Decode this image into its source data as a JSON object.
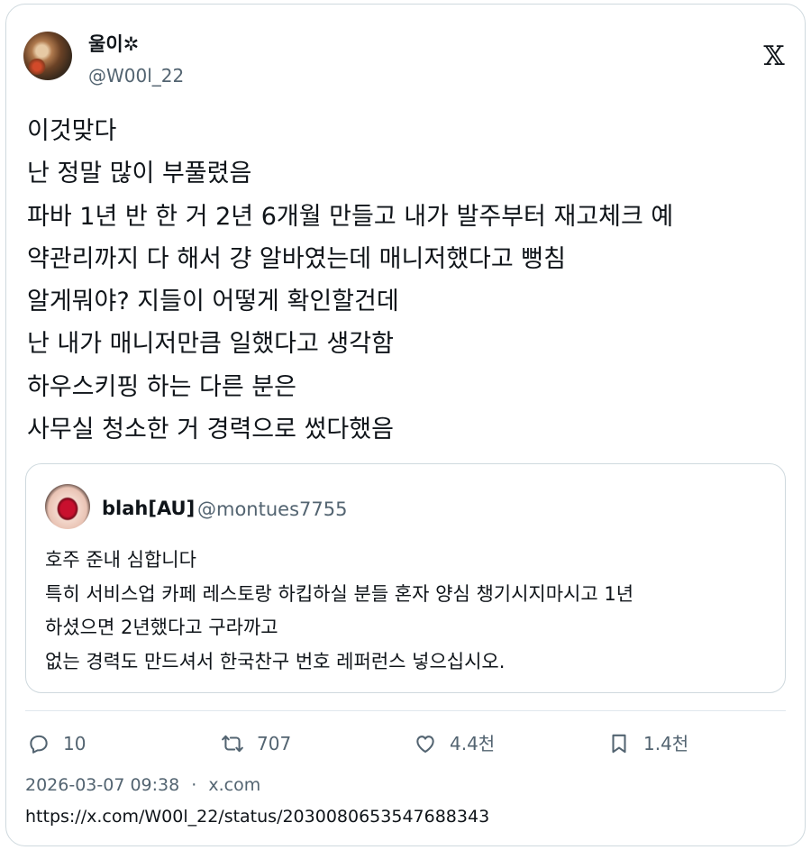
{
  "author": {
    "display_name": "울이✲",
    "username": "@W00l_22"
  },
  "tweet": {
    "lines": [
      "이것맞다",
      "난 정말 많이 부풀렸음",
      "파바 1년 반 한 거 2년 6개월 만들고 내가 발주부터 재고체크 예",
      "약관리까지 다 해서 걍 알바였는데 매니저했다고 뻥침",
      "알게뭐야? 지들이 어떻게 확인할건데",
      "난 내가 매니저만큼 일했다고 생각함",
      "하우스키핑 하는 다른 분은",
      "사무실 청소한 거 경력으로 썼다했음"
    ]
  },
  "quote": {
    "display_name": "blah[AU]",
    "username": "@montues7755",
    "lines": [
      "호주 준내 심합니다",
      "특히 서비스업 카페 레스토랑 하킵하실 분들 혼자 양심 챙기시지마시고 1년",
      "하셨으면 2년했다고 구라까고",
      "없는 경력도 만드셔서 한국찬구 번호 레퍼런스 넣으십시오."
    ]
  },
  "actions": {
    "replies": "10",
    "reposts": "707",
    "likes": "4.4천",
    "bookmarks": "1.4천"
  },
  "meta": {
    "timestamp": "2026-03-07 09:38",
    "separator": "·",
    "source": "x.com",
    "url": "https://x.com/W00l_22/status/2030080653547688343"
  },
  "icons": {
    "logo": "x-logo-icon",
    "reply": "reply-icon",
    "repost": "repost-icon",
    "like": "heart-icon",
    "bookmark": "bookmark-icon"
  }
}
